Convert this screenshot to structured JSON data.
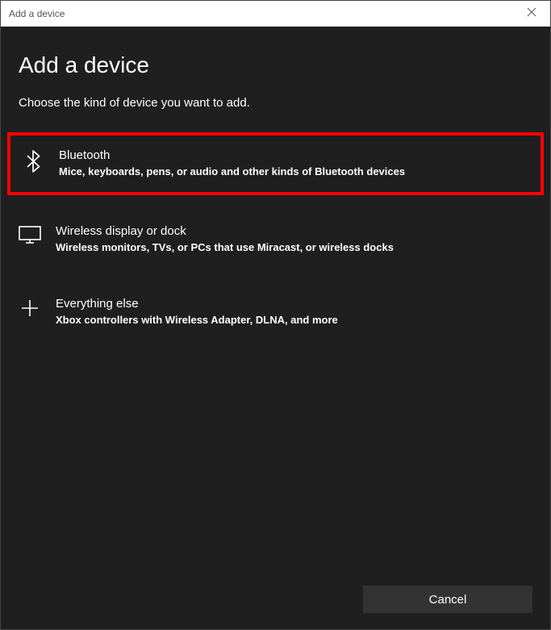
{
  "titlebar": {
    "title": "Add a device"
  },
  "main": {
    "heading": "Add a device",
    "subheading": "Choose the kind of device you want to add.",
    "options": [
      {
        "id": "bluetooth",
        "title": "Bluetooth",
        "desc": "Mice, keyboards, pens, or audio and other kinds of Bluetooth devices",
        "highlighted": true
      },
      {
        "id": "wireless-display",
        "title": "Wireless display or dock",
        "desc": "Wireless monitors, TVs, or PCs that use Miracast, or wireless docks",
        "highlighted": false
      },
      {
        "id": "everything-else",
        "title": "Everything else",
        "desc": "Xbox controllers with Wireless Adapter, DLNA, and more",
        "highlighted": false
      }
    ]
  },
  "footer": {
    "cancel_label": "Cancel"
  }
}
